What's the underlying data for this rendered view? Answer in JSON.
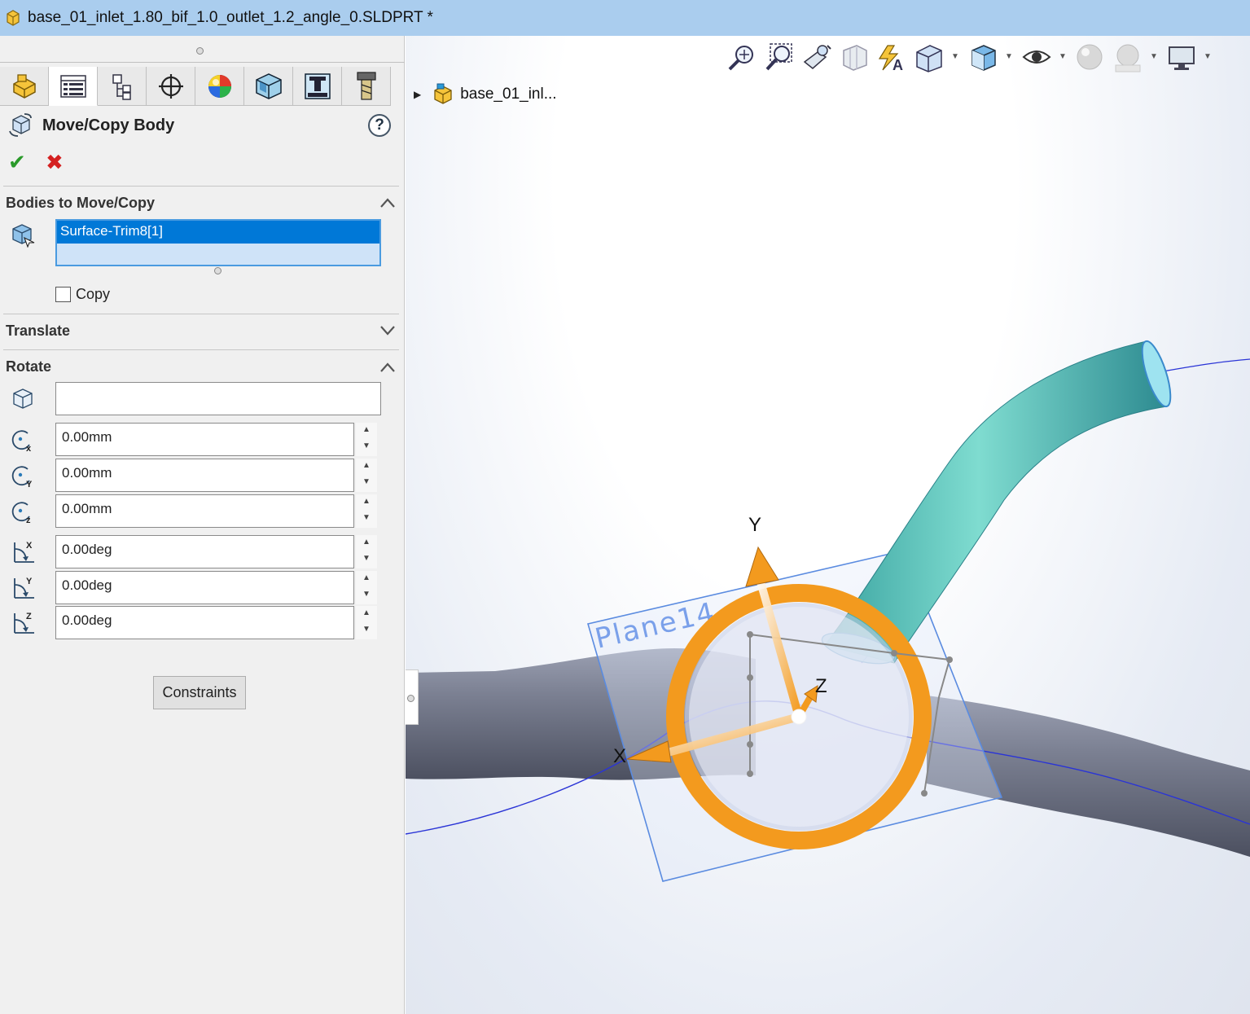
{
  "window": {
    "title": "base_01_inlet_1.80_bif_1.0_outlet_1.2_angle_0.SLDPRT *"
  },
  "property_manager": {
    "tabs": [
      "feature-manager-icon",
      "property-manager-icon",
      "configuration-manager-icon",
      "dimxpert-manager-icon",
      "display-manager-icon",
      "cam-feature-icon",
      "cam-operation-icon",
      "cam-toolpath-icon"
    ],
    "title": "Move/Copy Body",
    "help_label": "?",
    "ok_symbol": "✔",
    "cancel_symbol": "✖",
    "bodies_section": {
      "title": "Bodies to Move/Copy",
      "items": [
        "Surface-Trim8[1]"
      ],
      "copy_label": "Copy",
      "copy_checked": false
    },
    "translate_section": {
      "title": "Translate"
    },
    "rotate_section": {
      "title": "Rotate",
      "reference_value": "",
      "center_x": "0.00mm",
      "center_y": "0.00mm",
      "center_z": "0.00mm",
      "angle_x": "0.00deg",
      "angle_y": "0.00deg",
      "angle_z": "0.00deg"
    },
    "constraints_label": "Constraints"
  },
  "viewport": {
    "tree_root_label": "base_01_inl...",
    "toolbar": [
      "zoom-to-fit-icon",
      "zoom-to-area-icon",
      "previous-view-icon",
      "section-view-icon",
      "dynamic-annotation-views-icon",
      "view-orientation-icon",
      "display-style-icon",
      "hide-show-items-icon",
      "edit-appearance-icon",
      "apply-scene-icon",
      "view-settings-icon"
    ],
    "triad_labels": {
      "x": "X",
      "y": "Y",
      "z": "Z"
    },
    "plane_label": "Plane14",
    "colors": {
      "ring": "#f39a1e",
      "outlet_tube": "#5cc6b8",
      "main_pipe": "#6e7385",
      "plane": "#5a8be0"
    }
  }
}
